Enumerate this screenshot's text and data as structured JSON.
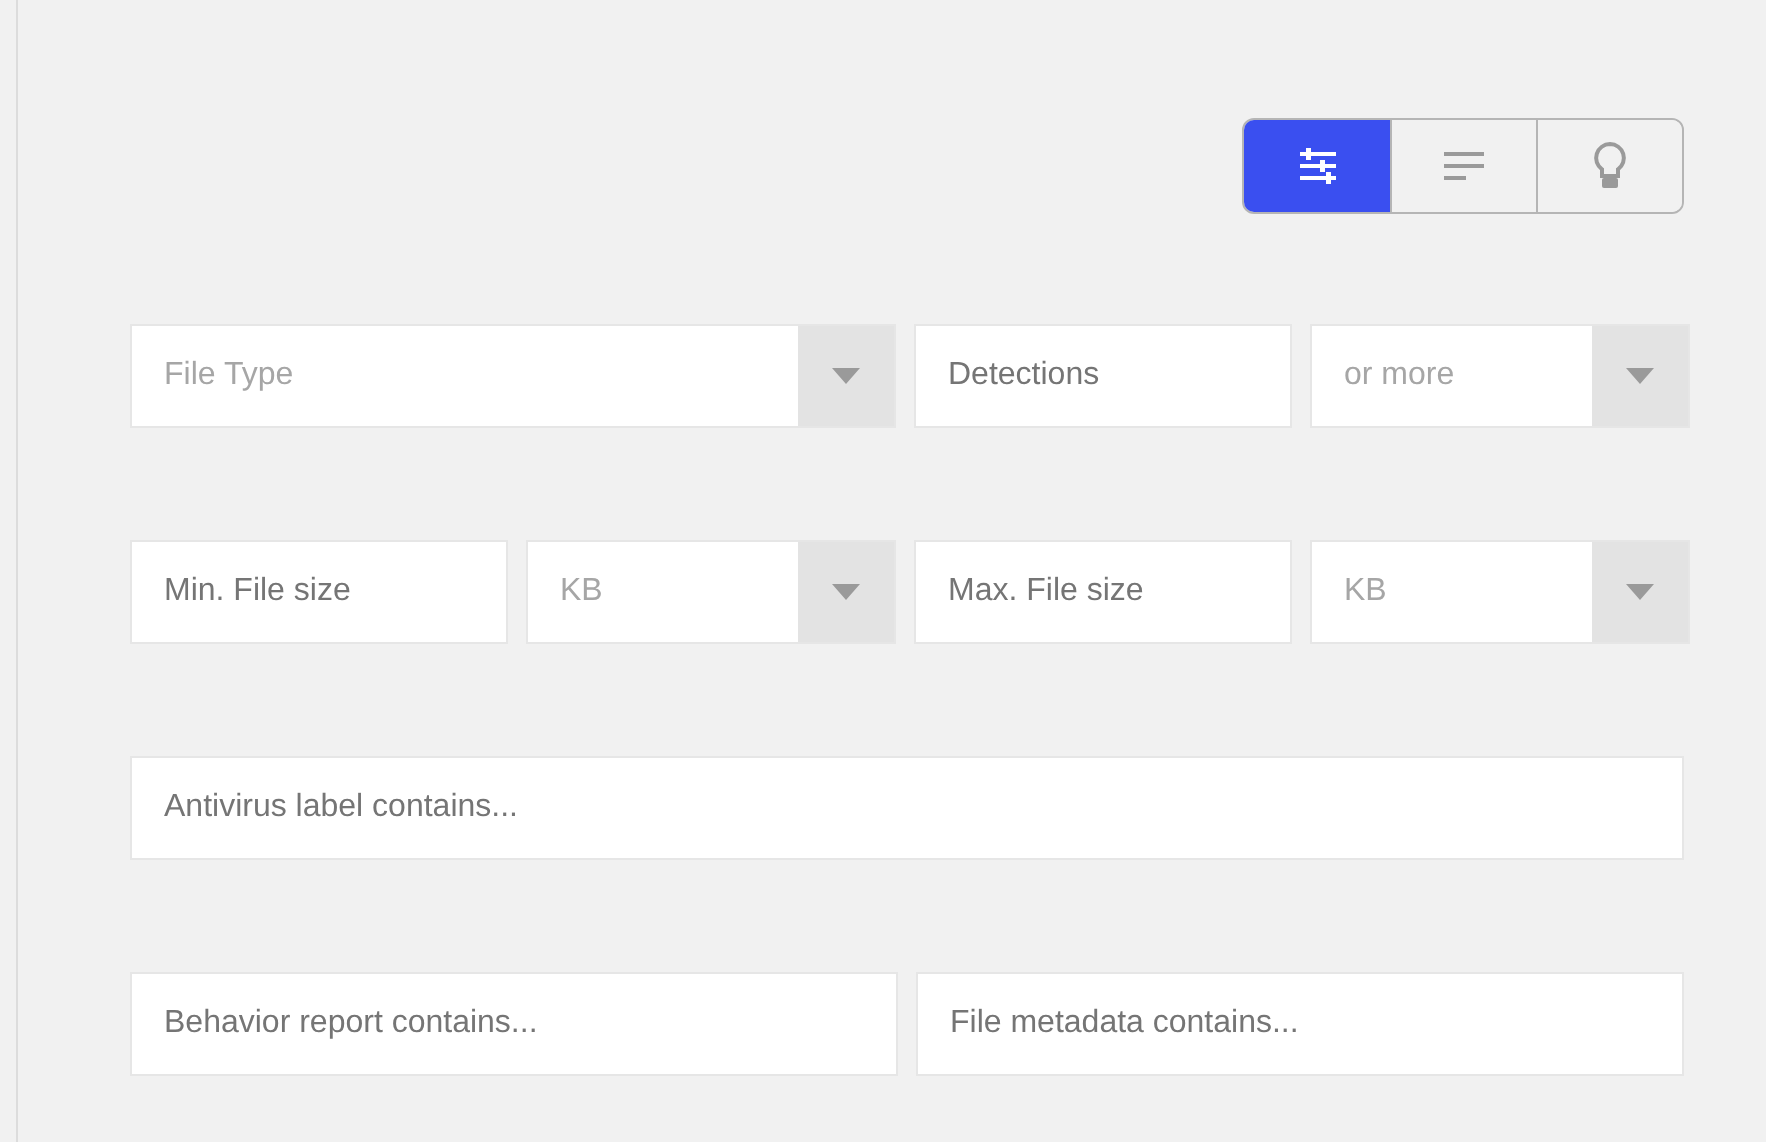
{
  "view_toggle": [
    {
      "kind": "filters",
      "selected": true
    },
    {
      "kind": "list",
      "selected": false
    },
    {
      "kind": "tips",
      "selected": false
    }
  ],
  "rows": [
    [
      {
        "kind": "select",
        "value": "File Type"
      },
      {
        "kind": "input",
        "placeholder": "Detections"
      },
      {
        "kind": "select",
        "value": "or more"
      }
    ],
    [
      {
        "kind": "input",
        "placeholder": "Min. File size"
      },
      {
        "kind": "select",
        "value": "KB"
      },
      {
        "kind": "input",
        "placeholder": "Max. File size"
      },
      {
        "kind": "select",
        "value": "KB"
      }
    ],
    [
      {
        "kind": "input",
        "placeholder": "Antivirus label contains..."
      }
    ],
    [
      {
        "kind": "input",
        "placeholder": "Behavior report contains..."
      },
      {
        "kind": "input",
        "placeholder": "File metadata contains..."
      }
    ]
  ]
}
